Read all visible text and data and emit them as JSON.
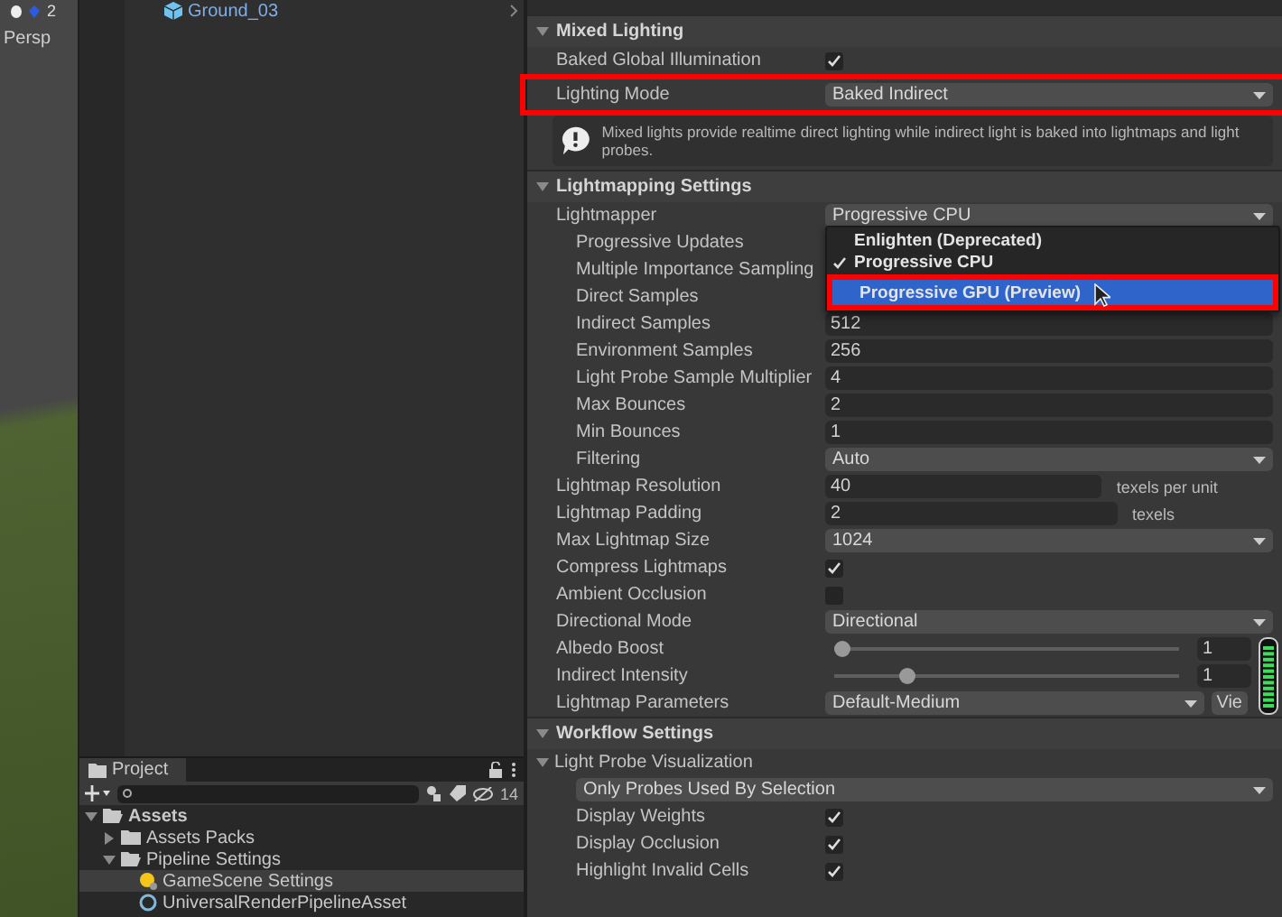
{
  "scene_view": {
    "label": "Persp",
    "count": "2"
  },
  "hierarchy": {
    "items": [
      {
        "label": "Ground_03"
      }
    ]
  },
  "project": {
    "tab": "Project",
    "hidden_count": "14",
    "tree": [
      {
        "label": "Assets",
        "kind": "folder",
        "expanded": true,
        "selected": false,
        "children": [
          {
            "label": "Assets Packs",
            "kind": "folder",
            "expanded": false,
            "selected": false
          },
          {
            "label": "Pipeline Settings",
            "kind": "folder",
            "expanded": true,
            "selected": false,
            "children": [
              {
                "label": "GameScene Settings",
                "kind": "lighting",
                "selected": true
              },
              {
                "label": "UniversalRenderPipelineAsset",
                "kind": "pipeline",
                "selected": false
              }
            ]
          }
        ]
      }
    ]
  },
  "inspector": {
    "sections": [
      {
        "title": "Mixed Lighting",
        "expanded": true,
        "rows": [
          {
            "kind": "checkbox",
            "label": "Baked Global Illumination",
            "checked": true
          },
          {
            "kind": "dropdown",
            "label": "Lighting Mode",
            "value": "Baked Indirect",
            "highlighted": true
          },
          {
            "kind": "help",
            "text": "Mixed lights provide realtime direct lighting while indirect light is baked into lightmaps and light probes."
          }
        ]
      },
      {
        "title": "Lightmapping Settings",
        "expanded": true,
        "rows": [
          {
            "kind": "dropdown",
            "label": "Lightmapper",
            "value": "Progressive CPU",
            "children": [
              {
                "kind": "label",
                "label": "Progressive Updates"
              },
              {
                "kind": "label",
                "label": "Multiple Importance Sampling"
              },
              {
                "kind": "label",
                "label": "Direct Samples"
              },
              {
                "kind": "field",
                "label": "Indirect Samples",
                "value": "512"
              },
              {
                "kind": "field",
                "label": "Environment Samples",
                "value": "256"
              },
              {
                "kind": "field",
                "label": "Light Probe Sample Multiplier",
                "value": "4"
              },
              {
                "kind": "field",
                "label": "Max Bounces",
                "value": "2"
              },
              {
                "kind": "field",
                "label": "Min Bounces",
                "value": "1"
              },
              {
                "kind": "dropdown",
                "label": "Filtering",
                "value": "Auto"
              }
            ]
          },
          {
            "kind": "unit_field",
            "label": "Lightmap Resolution",
            "value": "40",
            "unit": "texels per unit"
          },
          {
            "kind": "unit_field",
            "label": "Lightmap Padding",
            "value": "2",
            "unit": "texels"
          },
          {
            "kind": "dropdown",
            "label": "Max Lightmap Size",
            "value": "1024"
          },
          {
            "kind": "checkbox",
            "label": "Compress Lightmaps",
            "checked": true
          },
          {
            "kind": "checkbox",
            "label": "Ambient Occlusion",
            "checked": false
          },
          {
            "kind": "dropdown",
            "label": "Directional Mode",
            "value": "Directional"
          },
          {
            "kind": "slider",
            "label": "Albedo Boost",
            "level": 0,
            "value": "1"
          },
          {
            "kind": "slider",
            "label": "Indirect Intensity",
            "level": 0.2,
            "value": "1"
          },
          {
            "kind": "dropdown_button",
            "label": "Lightmap Parameters",
            "value": "Default-Medium",
            "button": "Vie"
          }
        ]
      },
      {
        "title": "Workflow Settings",
        "expanded": true,
        "rows": [
          {
            "kind": "foldout",
            "label": "Light Probe Visualization",
            "expanded": true,
            "children": [
              {
                "kind": "wide_dropdown",
                "value": "Only Probes Used By Selection"
              },
              {
                "kind": "checkbox",
                "label": "Display Weights",
                "checked": true
              },
              {
                "kind": "checkbox",
                "label": "Display Occlusion",
                "checked": true
              },
              {
                "kind": "checkbox",
                "label": "Highlight Invalid Cells",
                "checked": true
              }
            ]
          }
        ]
      }
    ]
  },
  "dropdown_menu": {
    "items": [
      {
        "label": "Enlighten (Deprecated)",
        "checked": false,
        "selected": false
      },
      {
        "label": "Progressive CPU",
        "checked": true,
        "selected": false
      },
      {
        "label": "Progressive GPU (Preview)",
        "checked": false,
        "selected": true,
        "highlighted": true
      }
    ]
  }
}
